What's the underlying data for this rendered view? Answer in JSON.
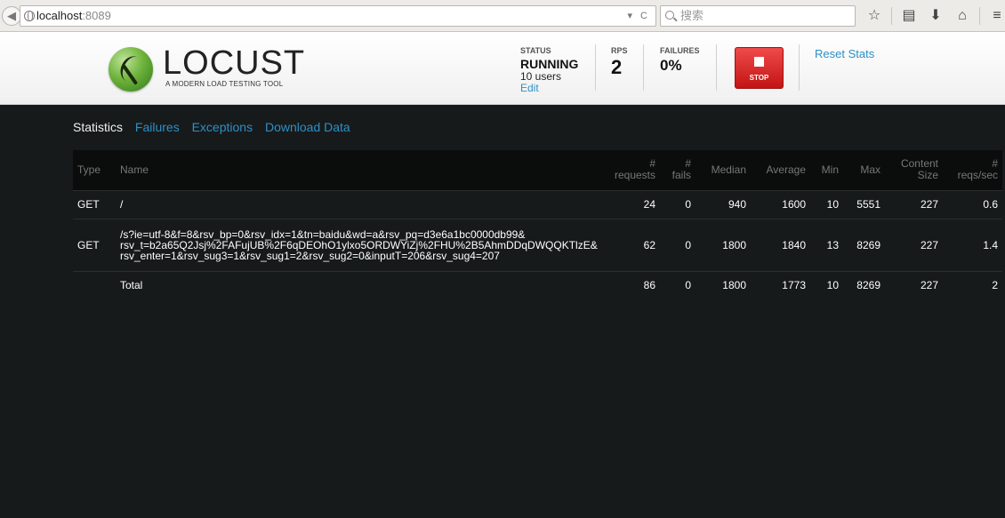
{
  "browser": {
    "back_glyph": "◀",
    "url_host": "localhost",
    "url_port": ":8089",
    "url_tools": "▾ C",
    "search_placeholder": "搜索",
    "icons": [
      "star-icon",
      "bookmarks-icon",
      "download-icon",
      "home-icon",
      "menu-icon"
    ],
    "icon_glyphs": {
      "star": "☆",
      "bookmarks": "▤",
      "download": "⬇",
      "home": "⌂",
      "menu": "≡"
    }
  },
  "header": {
    "logo_text": "LOCUST",
    "tagline": "A MODERN LOAD TESTING TOOL",
    "status_label": "STATUS",
    "status_value": "RUNNING",
    "users": "10 users",
    "edit_label": "Edit",
    "rps_label": "RPS",
    "rps_value": "2",
    "failures_label": "FAILURES",
    "failures_value": "0%",
    "stop_label": "STOP",
    "reset_label": "Reset Stats"
  },
  "nav": {
    "tabs": [
      {
        "label": "Statistics",
        "active": true
      },
      {
        "label": "Failures",
        "active": false
      },
      {
        "label": "Exceptions",
        "active": false
      },
      {
        "label": "Download Data",
        "active": false
      }
    ]
  },
  "table": {
    "headers": {
      "type": "Type",
      "name": "Name",
      "requests_1": "#",
      "requests_2": "requests",
      "fails_1": "#",
      "fails_2": "fails",
      "median": "Median",
      "average": "Average",
      "min": "Min",
      "max": "Max",
      "content_1": "Content",
      "content_2": "Size",
      "reqs_1": "#",
      "reqs_2": "reqs/sec"
    },
    "rows": [
      {
        "type": "GET",
        "name_lines": [
          "/"
        ],
        "requests": "24",
        "fails": "0",
        "median": "940",
        "average": "1600",
        "min": "10",
        "max": "5551",
        "content_size": "227",
        "reqs_sec": "0.6"
      },
      {
        "type": "GET",
        "name_lines": [
          "/s?ie=utf-8&f=8&rsv_bp=0&rsv_idx=1&tn=baidu&wd=a&rsv_pq=d3e6a1bc0000db99&",
          "rsv_t=b2a65Q2Jsj%2FAFujUB%2F6qDEOhO1ylxo5ORDWYiZj%2FHU%2B5AhmDDqDWQQKTlzE&",
          "rsv_enter=1&rsv_sug3=1&rsv_sug1=2&rsv_sug2=0&inputT=206&rsv_sug4=207"
        ],
        "requests": "62",
        "fails": "0",
        "median": "1800",
        "average": "1840",
        "min": "13",
        "max": "8269",
        "content_size": "227",
        "reqs_sec": "1.4"
      }
    ],
    "total": {
      "type": "",
      "name": "Total",
      "requests": "86",
      "fails": "0",
      "median": "1800",
      "average": "1773",
      "min": "10",
      "max": "8269",
      "content_size": "227",
      "reqs_sec": "2"
    }
  }
}
